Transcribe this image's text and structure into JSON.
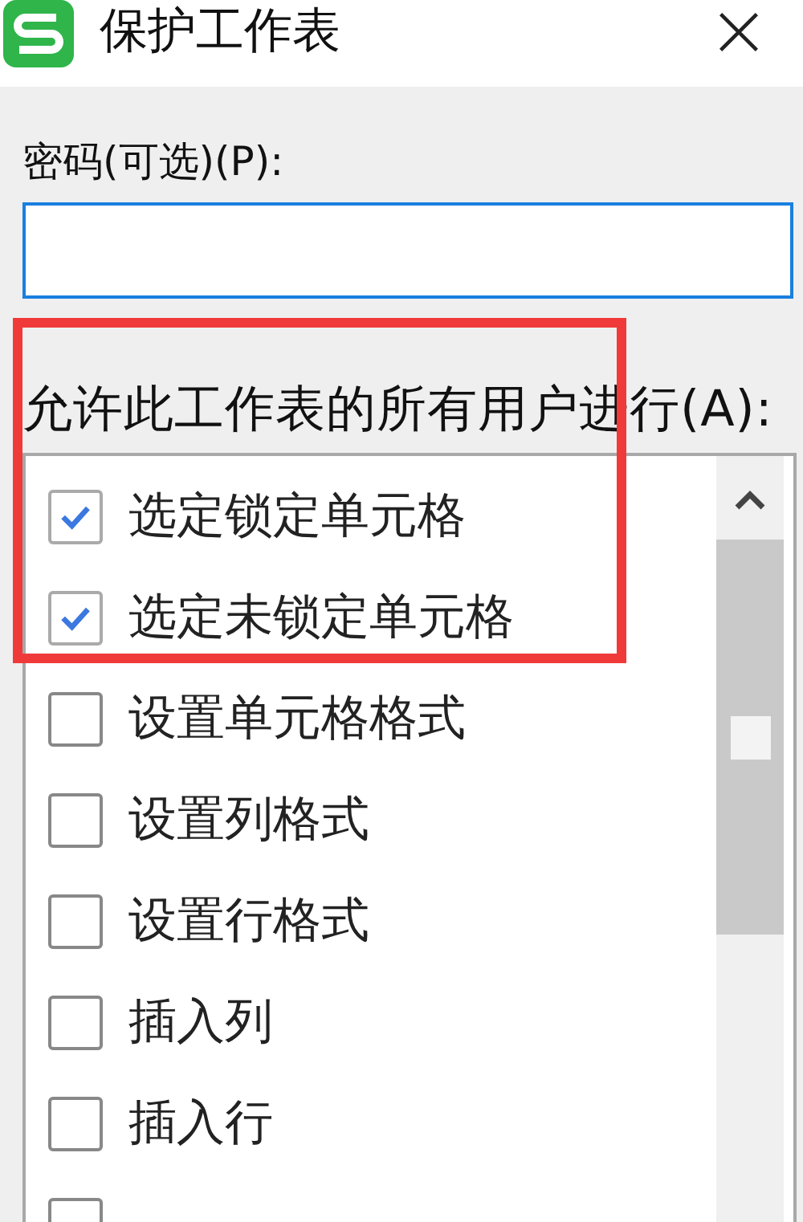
{
  "window": {
    "title": "保护工作表"
  },
  "password": {
    "label": "密码(可选)(P):",
    "focused": true
  },
  "permissions": {
    "label": "允许此工作表的所有用户进行(A):",
    "items": [
      {
        "label": "选定锁定单元格",
        "checked": true
      },
      {
        "label": "选定未锁定单元格",
        "checked": true
      },
      {
        "label": "设置单元格格式",
        "checked": false
      },
      {
        "label": "设置列格式",
        "checked": false
      },
      {
        "label": "设置行格式",
        "checked": false
      },
      {
        "label": "插入列",
        "checked": false
      },
      {
        "label": "插入行",
        "checked": false
      },
      {
        "checked": false
      }
    ]
  },
  "annotation": {
    "kind": "highlight-box",
    "color": "#f03a3a"
  }
}
